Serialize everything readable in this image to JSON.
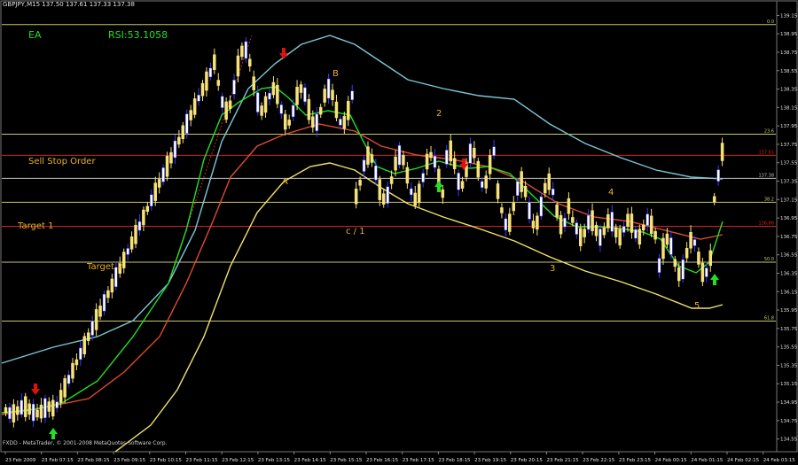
{
  "window": {
    "title": "GBPJPY,M15  137.50 137.61 137.33 137.38",
    "footer": "FXDD - MetaTrader, © 2001-2008 MetaQuotes Software Corp."
  },
  "labels": {
    "ea": "EA",
    "rsi": "RSI:53.1058",
    "sell_stop": "Sell Stop Order",
    "target1": "Target 1",
    "target2": "Target 2",
    "wave_b": "B",
    "wave_a": "A",
    "wave_c1": "c / 1",
    "wave_2": "2",
    "wave_3": "3",
    "wave_4": "4",
    "wave_5": "5"
  },
  "colors": {
    "background": "#000000",
    "bull": "#f7e27a",
    "bear": "#ffffff",
    "bear_edge": "#3a3aff",
    "upper_band": "#7cc7d8",
    "lower_band": "#f2e36a",
    "mid_red": "#e04b2f",
    "fast_green": "#22e022",
    "fib_line": "#c8c870",
    "level_red": "#d62020",
    "ea_text": "#22e022",
    "annot_text": "#e8b030"
  },
  "levels": [
    {
      "name": "fib-0",
      "price": 139.05,
      "color": "#c8c870",
      "fib": "0.0"
    },
    {
      "name": "fib-23",
      "price": 137.86,
      "color": "#c8c870",
      "fib": "23.6"
    },
    {
      "name": "sell-stop",
      "price": 137.63,
      "color": "#d62020",
      "fib": "137.61"
    },
    {
      "name": "current",
      "price": 137.38,
      "color": "#c0c0c0",
      "fib": "137.38"
    },
    {
      "name": "fib-38",
      "price": 137.12,
      "color": "#c8c870",
      "fib": "38.2"
    },
    {
      "name": "target1",
      "price": 136.86,
      "color": "#d62020",
      "fib": "136.86"
    },
    {
      "name": "fib-50",
      "price": 136.47,
      "color": "#c8c870",
      "fib": "50.0"
    },
    {
      "name": "fib-61",
      "price": 135.83,
      "color": "#c8c870",
      "fib": "61.8"
    }
  ],
  "chart_data": {
    "type": "candlestick",
    "symbol": "GBPJPY",
    "timeframe": "M15",
    "ylim": [
      134.45,
      139.25
    ],
    "y_ticks": [
      139.15,
      138.95,
      138.75,
      138.55,
      138.35,
      138.15,
      137.95,
      137.75,
      137.55,
      137.35,
      137.15,
      136.95,
      136.75,
      136.55,
      136.35,
      136.15,
      135.95,
      135.75,
      135.55,
      135.35,
      135.15,
      134.95,
      134.75,
      134.55
    ],
    "x_ticks": [
      "23 Feb 2009",
      "23 Feb 07:15",
      "23 Feb 08:15",
      "23 Feb 09:15",
      "23 Feb 10:15",
      "23 Feb 11:15",
      "23 Feb 12:15",
      "23 Feb 13:15",
      "23 Feb 14:15",
      "23 Feb 15:15",
      "23 Feb 16:15",
      "23 Feb 17:15",
      "23 Feb 18:15",
      "23 Feb 19:15",
      "23 Feb 20:15",
      "23 Feb 21:15",
      "23 Feb 22:15",
      "23 Feb 23:15",
      "24 Feb 00:15",
      "24 Feb 01:15",
      "24 Feb 02:15",
      "24 Feb 03:15"
    ]
  }
}
